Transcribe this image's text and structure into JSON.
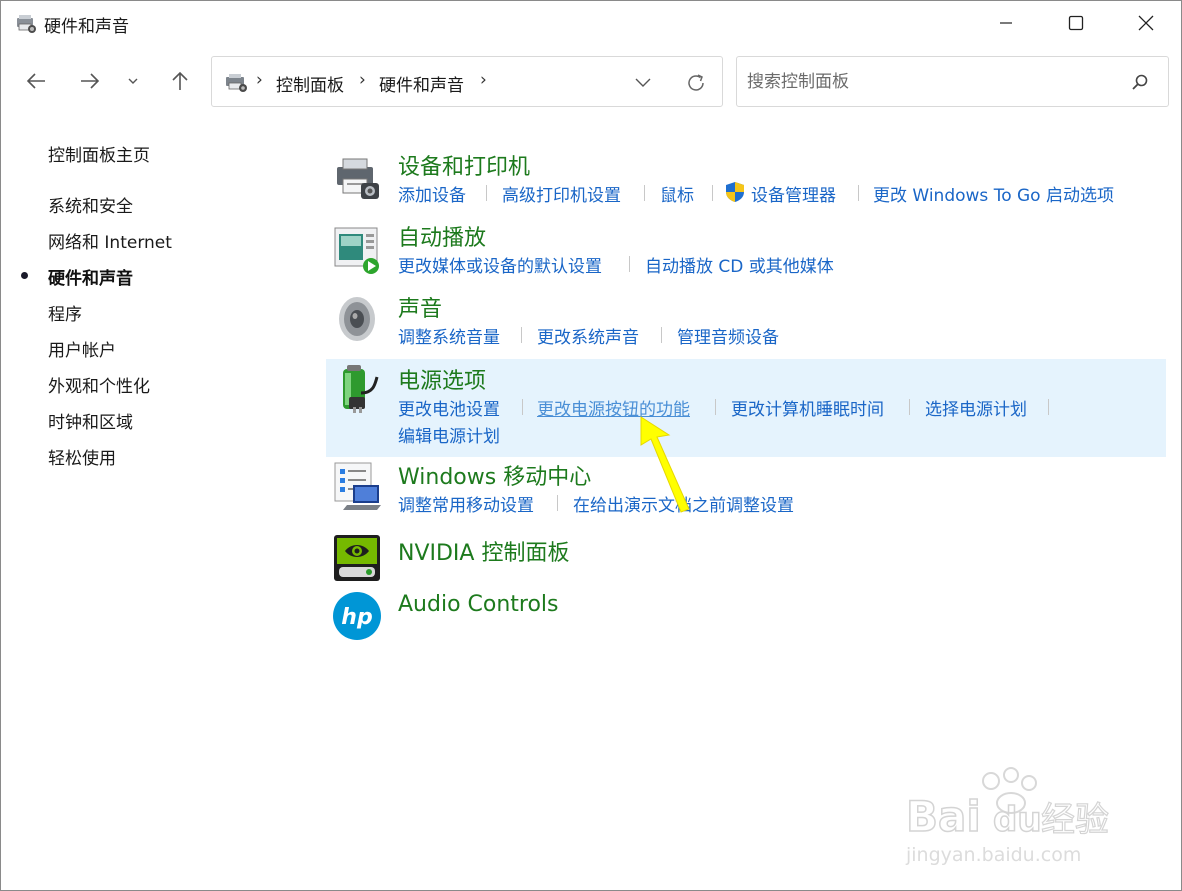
{
  "window": {
    "title": "硬件和声音"
  },
  "address": {
    "crumbs": [
      "控制面板",
      "硬件和声音"
    ],
    "separator": "›"
  },
  "search": {
    "placeholder": "搜索控制面板"
  },
  "sidebar": {
    "home": "控制面板主页",
    "items": [
      {
        "label": "系统和安全"
      },
      {
        "label": "网络和 Internet"
      },
      {
        "label": "硬件和声音",
        "active": true
      },
      {
        "label": "程序"
      },
      {
        "label": "用户帐户"
      },
      {
        "label": "外观和个性化"
      },
      {
        "label": "时钟和区域"
      },
      {
        "label": "轻松使用"
      }
    ]
  },
  "categories": [
    {
      "title": "设备和打印机",
      "icon": "printer-icon",
      "links": [
        "添加设备",
        "高级打印机设置",
        "鼠标",
        "设备管理器",
        "更改 Windows To Go 启动选项"
      ]
    },
    {
      "title": "自动播放",
      "icon": "autoplay-icon",
      "links": [
        "更改媒体或设备的默认设置",
        "自动播放 CD 或其他媒体"
      ]
    },
    {
      "title": "声音",
      "icon": "speaker-icon",
      "links": [
        "调整系统音量",
        "更改系统声音",
        "管理音频设备"
      ]
    },
    {
      "title": "电源选项",
      "icon": "battery-icon",
      "links": [
        "更改电池设置",
        "更改电源按钮的功能",
        "更改计算机睡眠时间",
        "选择电源计划",
        "编辑电源计划"
      ]
    },
    {
      "title": "Windows 移动中心",
      "icon": "mobility-center-icon",
      "links": [
        "调整常用移动设置",
        "在给出演示文档之前调整设置"
      ]
    },
    {
      "title": "NVIDIA 控制面板",
      "icon": "nvidia-icon",
      "links": []
    },
    {
      "title": "Audio Controls",
      "icon": "hp-icon",
      "links": []
    }
  ],
  "colors": {
    "category_title": "#1d7a1d",
    "link": "#1a66c7",
    "highlight": "#e5f3fd",
    "arrow": "#ffff00"
  },
  "watermark": {
    "brand": "Baidu经验",
    "url": "jingyan.baidu.com"
  }
}
